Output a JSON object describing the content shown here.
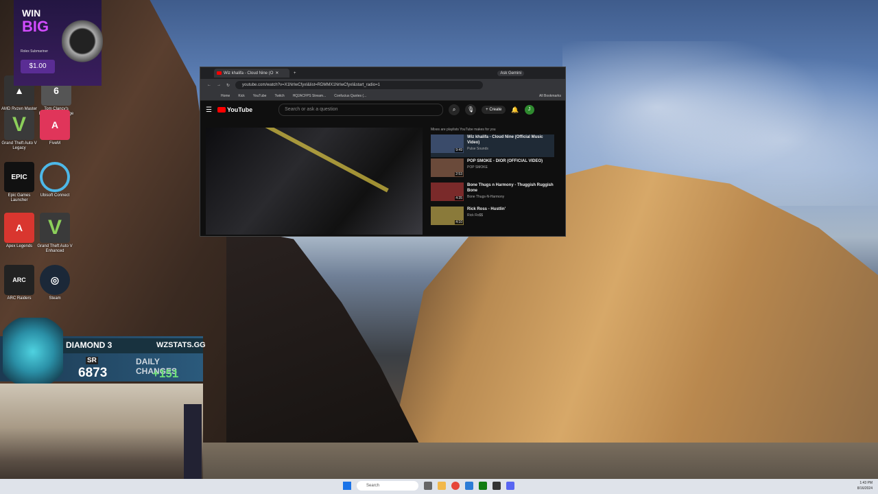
{
  "promo": {
    "line1": "WIN",
    "line2": "BIG",
    "item": "Rolex Submariner",
    "price": "$1.00"
  },
  "desktop_icons": [
    {
      "label": "AMD Ryzen Master"
    },
    {
      "label": "Tom Clancy's Rainbow Six Siege"
    },
    {
      "label": "Grand Theft Auto V Legacy"
    },
    {
      "label": "FiveM"
    },
    {
      "label": "Epic Games Launcher"
    },
    {
      "label": "Ubisoft Connect"
    },
    {
      "label": "Apex Legends"
    },
    {
      "label": "Grand Theft Auto V Enhanced"
    },
    {
      "label": "ARC Raiders"
    },
    {
      "label": "Steam"
    }
  ],
  "browser": {
    "tab_title": "Wiz khalifa - Cloud Nine (O",
    "gemini": "Ask Gemini",
    "url": "youtube.com/watch?v=X1NrIwCfyxI&list=RDMMX1NrIwCfyxI&start_radio=1",
    "bookmarks": [
      "Home",
      "Kick",
      "YouTube",
      "Twitch",
      "HQ2ACFPS Stream...",
      "Confucius Quotes (...",
      "All Bookmarks"
    ]
  },
  "youtube": {
    "logo": "YouTube",
    "search_placeholder": "Search or ask a question",
    "create": "Create",
    "avatar": "J",
    "playlist_header": "Mixes are playlists YouTube makes for you",
    "items": [
      {
        "title": "Wiz khalifa - Cloud Nine (Official Music Video)",
        "channel": "Pulse Sounds",
        "duration": "9:49"
      },
      {
        "title": "POP SMOKE - DIOR (OFFICIAL VIDEO)",
        "channel": "POP SMOKE",
        "duration": "2:53"
      },
      {
        "title": "Bone Thugs n Harmony - Thuggish Ruggish Bone",
        "channel": "Bone Thugs-N-Harmony",
        "duration": "4:35"
      },
      {
        "title": "Rick Ross - Hustlin'",
        "channel": "Rick Ro$$",
        "duration": "4:10"
      }
    ]
  },
  "overlay": {
    "rank": "DIAMOND 3",
    "site": "WZSTATS.GG",
    "sr_label": "SR",
    "sr": "6873",
    "daily_label": "DAILY CHANGES",
    "daily": "+151"
  },
  "taskbar": {
    "search": "Search",
    "time": "1:43 PM",
    "date": "8/16/2024"
  }
}
